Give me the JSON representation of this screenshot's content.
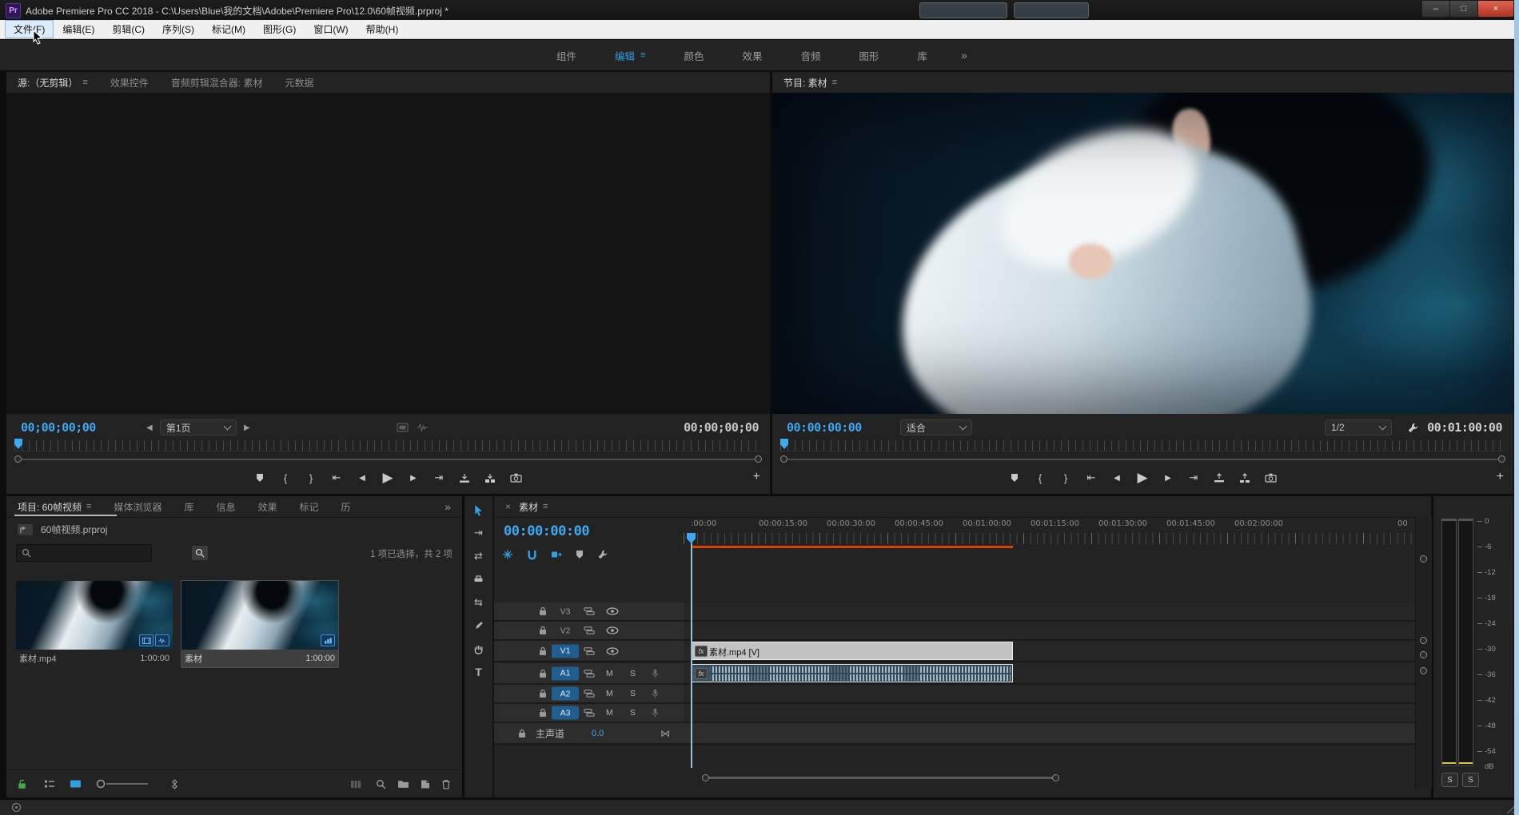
{
  "titlebar": {
    "app": "Pr",
    "title": "Adobe Premiere Pro CC 2018 - C:\\Users\\Blue\\我的文档\\Adobe\\Premiere Pro\\12.0\\60帧视频.prproj *",
    "minimize": "–",
    "maximize": "□",
    "close": "×"
  },
  "menubar": {
    "items": [
      "文件(F)",
      "编辑(E)",
      "剪辑(C)",
      "序列(S)",
      "标记(M)",
      "图形(G)",
      "窗口(W)",
      "帮助(H)"
    ]
  },
  "workspace": {
    "tabs": [
      "组件",
      "编辑",
      "颜色",
      "效果",
      "音频",
      "图形",
      "库"
    ],
    "active": "编辑",
    "overflow": "»",
    "menu": "≡"
  },
  "source": {
    "tabs": [
      "源:（无剪辑）",
      "效果控件",
      "音频剪辑混合器: 素材",
      "元数据"
    ],
    "menu": "≡",
    "timecode": "00;00;00;00",
    "page": "第1页",
    "duration": "00;00;00;00"
  },
  "program": {
    "title": "节目: 素材",
    "menu": "≡",
    "timecode": "00:00:00:00",
    "fit": "适合",
    "resolution": "1/2",
    "duration": "00:01:00:00"
  },
  "project": {
    "tabs": [
      "项目: 60帧视频",
      "媒体浏览器",
      "库",
      "信息",
      "效果",
      "标记",
      "历"
    ],
    "overflow": "»",
    "menu": "≡",
    "file_name": "60帧视频.prproj",
    "status": "1 项已选择，共 2 项",
    "items": [
      {
        "name": "素材.mp4",
        "duration": "1:00:00"
      },
      {
        "name": "素材",
        "duration": "1:00:00"
      }
    ]
  },
  "timeline": {
    "close": "×",
    "title": "素材",
    "menu": "≡",
    "timecode": "00:00:00:00",
    "ruler": [
      ":00:00",
      "00:00:15:00",
      "00:00:30:00",
      "00:00:45:00",
      "00:01:00:00",
      "00:01:15:00",
      "00:01:30:00",
      "00:01:45:00",
      "00:02:00:00",
      "00"
    ],
    "video_tracks": [
      "V3",
      "V2",
      "V1"
    ],
    "audio_tracks": [
      "A1",
      "A2",
      "A3"
    ],
    "mute": "M",
    "solo": "S",
    "master_label": "主声道",
    "master_level": "0.0",
    "clip": {
      "label": "素材.mp4 [V]",
      "fx": "fx"
    }
  },
  "meter": {
    "scale": [
      "0",
      "-6",
      "-12",
      "-18",
      "-24",
      "-30",
      "-36",
      "-42",
      "-48",
      "-54"
    ],
    "unit": "dB",
    "solo": "S"
  },
  "glyphs": {
    "mark_in": "{",
    "mark_out": "}",
    "go_in": "⇤",
    "go_out": "⇥",
    "step_back": "◀",
    "play": "▶",
    "step_fwd": "▶",
    "plus": "+",
    "prev": "◀",
    "next": "▶",
    "bowtie": "⋈",
    "type_tool": "T",
    "track_select": "⇥",
    "ripple": "⇄",
    "slip": "⇆"
  },
  "colors": {
    "accent_blue": "#2f9fe0",
    "timecode_blue": "#3ea8f0",
    "render_bar": "#dd4200",
    "target_track": "#1f5e8f",
    "peak_yellow": "#ddc93e"
  }
}
